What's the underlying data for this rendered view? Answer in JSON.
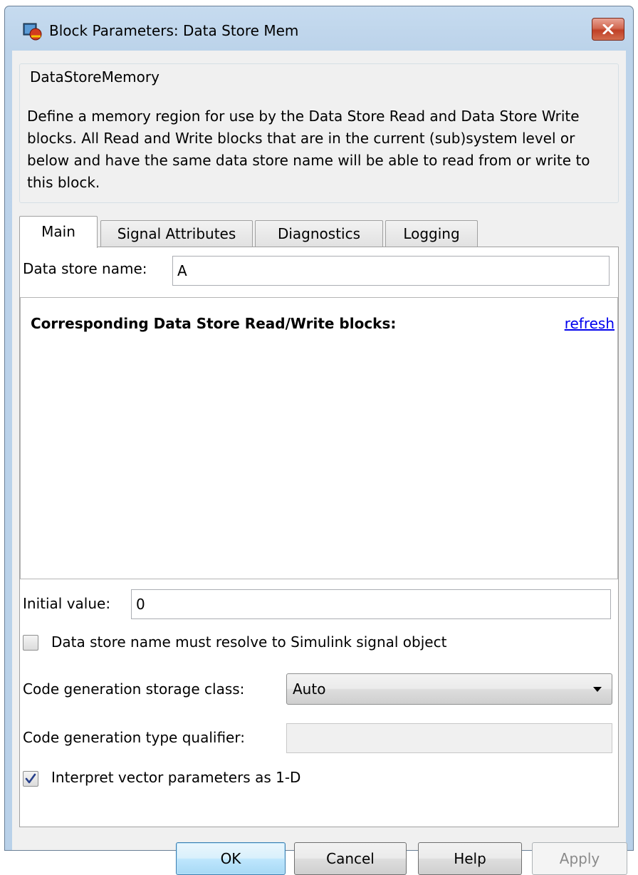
{
  "window": {
    "title": "Block Parameters: Data Store Mem"
  },
  "group": {
    "legend": "DataStoreMemory",
    "description": "Define a memory region for use by the Data Store Read and Data Store Write blocks. All Read and Write blocks that are in the current (sub)system level or below and have the same data store name will be able to read from or write to this block."
  },
  "tabs": [
    {
      "label": "Main",
      "active": true
    },
    {
      "label": "Signal Attributes",
      "active": false
    },
    {
      "label": "Diagnostics",
      "active": false
    },
    {
      "label": "Logging",
      "active": false
    }
  ],
  "main": {
    "data_store_name_label": "Data store name:",
    "data_store_name_value": "A",
    "rw_blocks_title": "Corresponding Data Store Read/Write blocks:",
    "refresh_link": "refresh",
    "initial_value_label": "Initial value:",
    "initial_value_value": "0",
    "resolve_checkbox_label": "Data store name must resolve to Simulink signal object",
    "resolve_checked": false,
    "storage_class_label": "Code generation storage class:",
    "storage_class_value": "Auto",
    "type_qualifier_label": "Code generation type qualifier:",
    "type_qualifier_value": "",
    "interpret_checkbox_label": "Interpret vector parameters as 1-D",
    "interpret_checked": true
  },
  "buttons": {
    "ok": "OK",
    "cancel": "Cancel",
    "help": "Help",
    "apply": "Apply"
  },
  "colors": {
    "title_bar": "#bcd3ea",
    "close_button": "#c8452c",
    "link": "#0000ee",
    "default_button": "#bee6fd"
  },
  "icons": {
    "app": "simulink-block-icon",
    "close": "close-icon",
    "dropdown": "chevron-down-icon",
    "check": "check-icon"
  }
}
